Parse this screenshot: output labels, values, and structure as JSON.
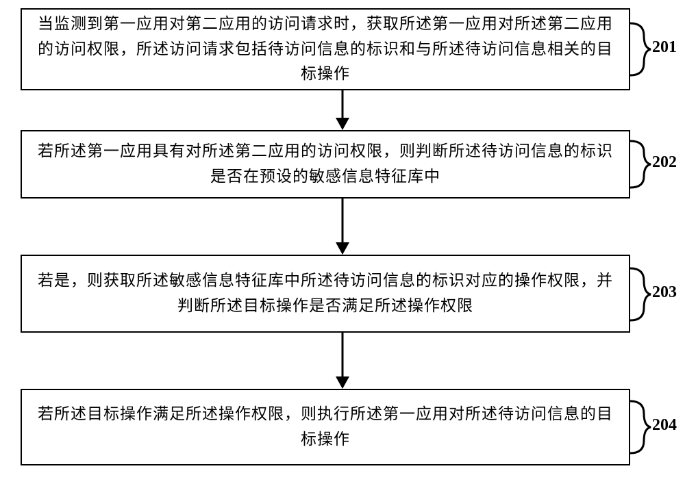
{
  "chart_data": {
    "type": "flowchart",
    "title": "",
    "direction": "top-to-bottom",
    "steps": [
      {
        "id": "201",
        "text": "当监测到第一应用对第二应用的访问请求时，获取所述第一应用对所述第二应用的访问权限，所述访问请求包括待访问信息的标识和与所述待访问信息相关的目标操作"
      },
      {
        "id": "202",
        "text": "若所述第一应用具有对所述第二应用的访问权限，则判断所述待访问信息的标识是否在预设的敏感信息特征库中"
      },
      {
        "id": "203",
        "text": "若是，则获取所述敏感信息特征库中所述待访问信息的标识对应的操作权限，并判断所述目标操作是否满足所述操作权限"
      },
      {
        "id": "204",
        "text": "若所述目标操作满足所述操作权限，则执行所述第一应用对所述待访问信息的目标操作"
      }
    ],
    "edges": [
      {
        "from": "201",
        "to": "202"
      },
      {
        "from": "202",
        "to": "203"
      },
      {
        "from": "203",
        "to": "204"
      }
    ]
  }
}
